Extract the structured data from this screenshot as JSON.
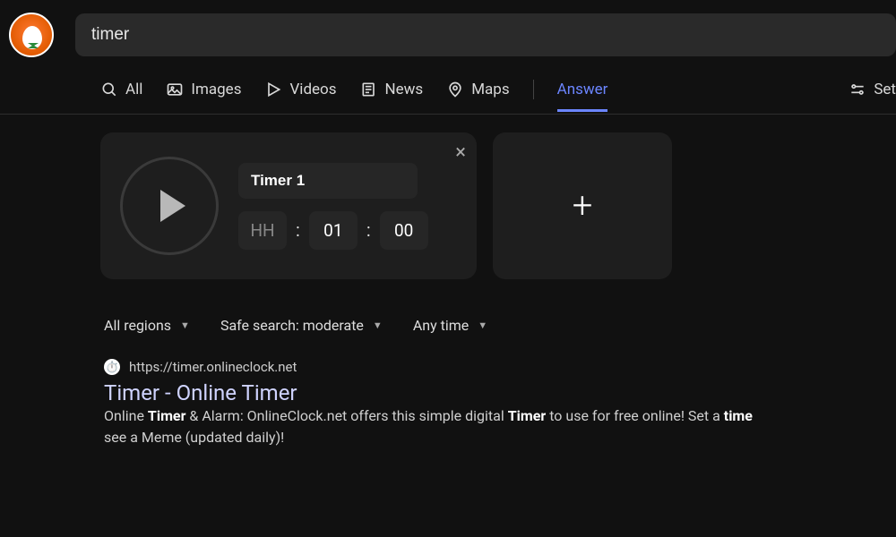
{
  "search": {
    "query": "timer"
  },
  "tabs": {
    "all": "All",
    "images": "Images",
    "videos": "Videos",
    "news": "News",
    "maps": "Maps",
    "answer": "Answer",
    "settings": "Set"
  },
  "timer": {
    "name": "Timer 1",
    "hh_placeholder": "HH",
    "mm": "01",
    "ss": "00",
    "sep": ":"
  },
  "filters": {
    "region": "All regions",
    "safesearch": "Safe search: moderate",
    "timeframe": "Any time"
  },
  "result": {
    "favicon_emoji": "⏱️",
    "url": "https://timer.onlineclock.net",
    "title": "Timer - Online Timer",
    "snippet_prefix": "Online ",
    "snippet_bold1": "Timer",
    "snippet_mid1": " & Alarm: OnlineClock.net offers this simple digital ",
    "snippet_bold2": "Timer",
    "snippet_mid2": " to use for free online! Set a ",
    "snippet_bold3": "time",
    "snippet_tail": " see a Meme (updated daily)!"
  },
  "colors": {
    "accent": "#6b85ff",
    "card_bg": "#1e1e1e",
    "page_bg": "#111111"
  }
}
